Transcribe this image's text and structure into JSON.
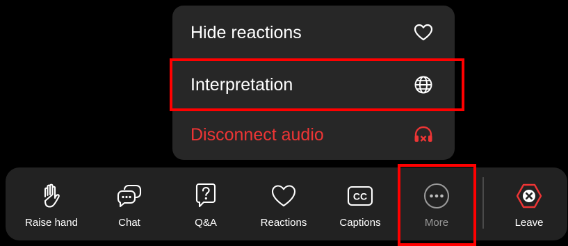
{
  "menu": {
    "items": [
      {
        "label": "Hide reactions",
        "icon": "heart-outline-icon"
      },
      {
        "label": "Interpretation",
        "icon": "globe-icon"
      },
      {
        "label": "Disconnect audio",
        "icon": "headphones-disconnect-icon",
        "color": "#ee3535"
      }
    ]
  },
  "toolbar": {
    "buttons": [
      {
        "label": "Raise hand",
        "icon": "hand-icon"
      },
      {
        "label": "Chat",
        "icon": "chat-icon"
      },
      {
        "label": "Q&A",
        "icon": "qa-icon"
      },
      {
        "label": "Reactions",
        "icon": "heart-outline-icon"
      },
      {
        "label": "Captions",
        "icon": "cc-icon"
      },
      {
        "label": "More",
        "icon": "more-dots-icon"
      },
      {
        "label": "Leave",
        "icon": "leave-icon",
        "color": "#ee3535"
      }
    ]
  },
  "annotations": {
    "highlight_color": "#ff0000"
  }
}
